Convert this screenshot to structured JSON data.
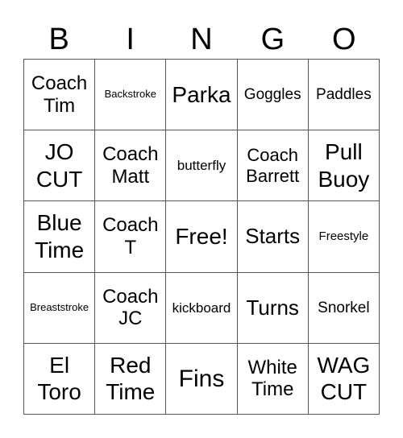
{
  "header": {
    "letters": [
      "B",
      "I",
      "N",
      "G",
      "O"
    ]
  },
  "board": {
    "cells": [
      [
        "Coach Tim",
        "Backstroke",
        "Parka",
        "Goggles",
        "Paddles"
      ],
      [
        "JO CUT",
        "Coach Matt",
        "butterfly",
        "Coach Barrett",
        "Pull Buoy"
      ],
      [
        "Blue Time",
        "Coach T",
        "Free!",
        "Starts",
        "Freestyle"
      ],
      [
        "Breaststroke",
        "Coach JC",
        "kickboard",
        "Turns",
        "Snorkel"
      ],
      [
        "El Toro",
        "Red Time",
        "Fins",
        "White Time",
        "WAG CUT"
      ]
    ],
    "free_space": "Free!"
  }
}
